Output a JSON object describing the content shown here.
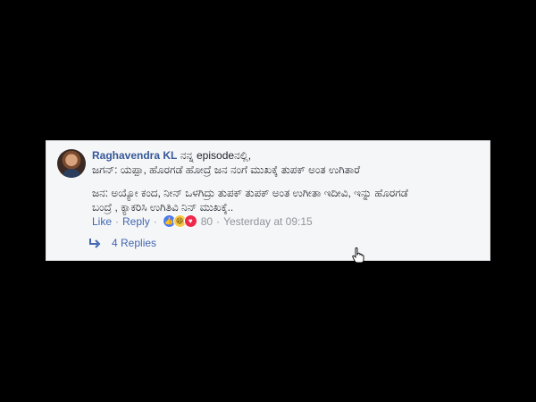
{
  "comment": {
    "author": "Raghavendra KL",
    "intro": "ನನ್ನ episodeನಲ್ಲಿ,",
    "line1": "ಜಗನ್: ಯಪ್ಪಾ, ಹೊರಗಡೆ ಹೋದ್ರೆ ಜನ ನಂಗೆ ಮುಖಕ್ಕೆ ತುಪಕ್ ಅಂತ ಉಗಿತಾರೆ",
    "line2": "ಜನ: ಅಯ್ಯೋ ಕಂದ, ನೀನ್ ಒಳಗಿದ್ರು ತುಪಕ್ ತುಪಕ್ ಅಂತ ಉಗೀತಾ ಇದೀವಿ, ಇನ್ನು ಹೊರಗಡೆ",
    "line3": "ಬಂದ್ರೆ , ಕ್ಯಾಕರಿಸಿ ಉಗಿತಿವಿ ನಿನ್ ಮುಖಕ್ಕೆ..",
    "actions": {
      "like": "Like",
      "reply": "Reply",
      "reaction_count": "80",
      "timestamp": "Yesterday at 09:15"
    },
    "replies_label": "4 Replies"
  },
  "icons": {
    "avatar": "profile-photo",
    "reactions": [
      "like-icon",
      "haha-icon",
      "love-icon"
    ],
    "reply_arrow": "reply-arrow-icon",
    "cursor": "hand-cursor-icon"
  },
  "colors": {
    "author": "#365899",
    "link": "#4267b2",
    "meta": "#90949c",
    "card_background": "#f5f6f7",
    "page_background": "#000000"
  }
}
